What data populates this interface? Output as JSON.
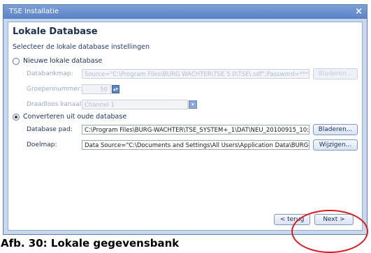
{
  "window": {
    "title": "TSE Installatie",
    "close_glyph": "×"
  },
  "page": {
    "heading": "Lokale Database",
    "subtitle": "Selecteer de lokale database instellingen"
  },
  "new_db": {
    "radio_label": "Nieuwe lokale database",
    "checked": false,
    "databankmap_label": "Databankmap:",
    "databankmap_value": "Source=\"C:\\Program Files\\BURG WACHTER\\TSE 5.0\\TSE\\.sdf\";Password=***",
    "databankmap_button": "Bladeren...",
    "groepennummer_label": "Groepennummer:",
    "groepennummer_value": "50",
    "draadloos_label": "Draadloos kanaal:",
    "draadloos_value": "Channel 1"
  },
  "convert_db": {
    "radio_label": "Converteren uit oude database",
    "checked": true,
    "pad_label": "Database pad:",
    "pad_value": "C:\\Program Files\\BURG-WACHTER\\TSE_SYSTEM+_1\\DAT\\NEU_20100915_10:",
    "pad_button": "Bladeren...",
    "doel_label": "Doelmap:",
    "doel_value": "Data Source=\"C:\\Documents and Settings\\All Users\\Application Data\\BURG-W",
    "doel_button": "Wijzigen..."
  },
  "footer": {
    "back_label": "< terug",
    "next_label": "Next >"
  },
  "caption": "Afb. 30: Lokale gegevensbank",
  "colors": {
    "highlight_circle": "#e0161c",
    "window_frame": "#c9d8ea"
  }
}
